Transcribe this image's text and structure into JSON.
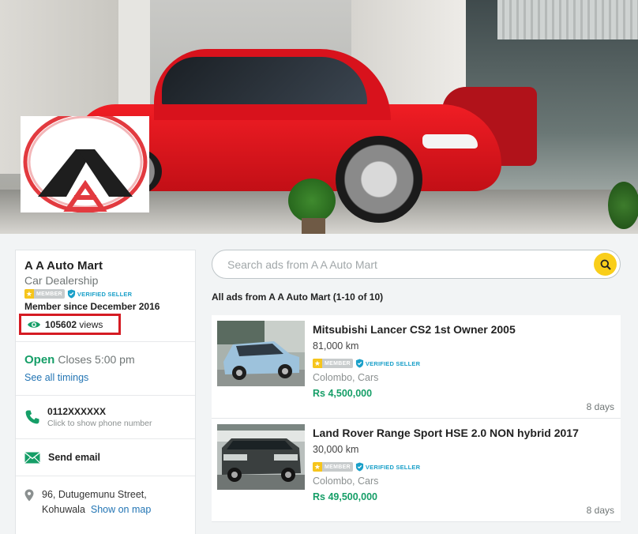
{
  "colors": {
    "accent_green": "#159e67",
    "link_blue": "#2375b4",
    "search_yellow": "#f9ce1a",
    "highlight_red": "#d51b23",
    "verified_blue": "#1aa0c9"
  },
  "shop": {
    "name": "A A Auto Mart",
    "type": "Car Dealership",
    "member_badge": "MEMBER",
    "verified_badge": "VERIFIED SELLER",
    "member_since": "Member since December 2016",
    "views_count": "105602",
    "views_label": "views"
  },
  "hours": {
    "status": "Open",
    "closes": "Closes 5:00 pm",
    "timings_link": "See all timings"
  },
  "phone": {
    "number": "0112XXXXXX",
    "hint": "Click to show phone number"
  },
  "email": {
    "label": "Send email"
  },
  "address": {
    "line1": "96, Dutugemunu Street,",
    "line2": "Kohuwala",
    "map_link": "Show on map"
  },
  "search": {
    "placeholder": "Search ads from A A Auto Mart"
  },
  "listings_heading": "All ads from A A Auto Mart (1-10 of 10)",
  "listings": [
    {
      "title": "Mitsubishi Lancer CS2 1st Owner 2005",
      "mileage": "81,000 km",
      "member_badge": "MEMBER",
      "verified_badge": "VERIFIED SELLER",
      "location": "Colombo, Cars",
      "price": "Rs 4,500,000",
      "age": "8 days"
    },
    {
      "title": "Land Rover Range Sport HSE 2.0 NON hybrid 2017",
      "mileage": "30,000 km",
      "member_badge": "MEMBER",
      "verified_badge": "VERIFIED SELLER",
      "location": "Colombo, Cars",
      "price": "Rs 49,500,000",
      "age": "8 days"
    }
  ],
  "icons": {
    "eye": "eye-icon",
    "phone": "phone-icon",
    "email": "envelope-icon",
    "location": "location-pin-icon",
    "search": "search-icon",
    "star": "star-icon",
    "shield": "verified-shield-icon"
  }
}
